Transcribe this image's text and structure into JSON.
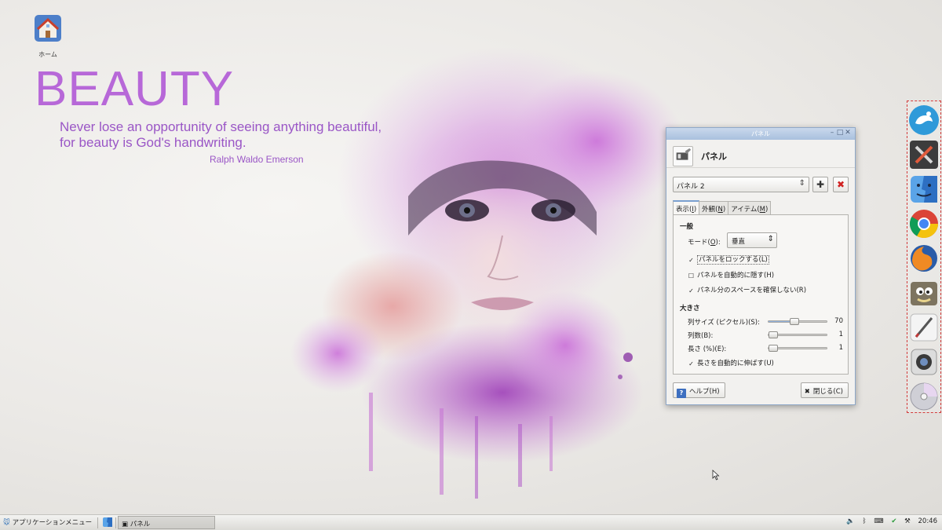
{
  "desktop": {
    "home_icon_label": "ホーム"
  },
  "wallpaper": {
    "title": "BEAUTY",
    "quote": "Never lose an opportunity of seeing anything beautiful, for beauty is God's handwriting.",
    "author": "Ralph Waldo Emerson"
  },
  "dock": {
    "items": [
      "xfce-mouse-icon",
      "settings-tools-icon",
      "finder-icon",
      "chrome-icon",
      "firefox-icon",
      "gimp-icon",
      "pen-icon",
      "webcam-icon",
      "cd-icon"
    ]
  },
  "window": {
    "title": "パネル",
    "header_title": "パネル",
    "panel_selected": "パネル 2",
    "tabs": [
      {
        "label": "表示(",
        "key": "I",
        "suffix": ")"
      },
      {
        "label": "外観(",
        "key": "N",
        "suffix": ")"
      },
      {
        "label": "アイテム(",
        "key": "M",
        "suffix": ")"
      }
    ],
    "section_general": "一般",
    "mode_label_pre": "モード(",
    "mode_label_key": "O",
    "mode_label_post": "):",
    "mode_value": "垂直",
    "lock_panel": "パネルをロックする(L)",
    "autohide": "パネルを自動的に隠す(H)",
    "no_reserve": "パネル分のスペースを確保しない(R)",
    "section_size": "大きさ",
    "row_size_label": "列サイズ (ピクセル)(S):",
    "row_size_value": "70",
    "rows_label": "列数(B):",
    "rows_value": "1",
    "length_label": "長さ (%)(E):",
    "length_value": "1",
    "autoextend": "長さを自動的に伸ばす(U)",
    "help_button": "ヘルプ(H)",
    "close_button": "閉じる(C)"
  },
  "taskbar": {
    "app_menu": "アプリケーションメニュー",
    "task_label": "パネル",
    "clock": "20:46"
  },
  "values": {
    "row_size_fraction": 0.45,
    "rows_fraction": 0.02,
    "length_fraction": 0.02
  }
}
